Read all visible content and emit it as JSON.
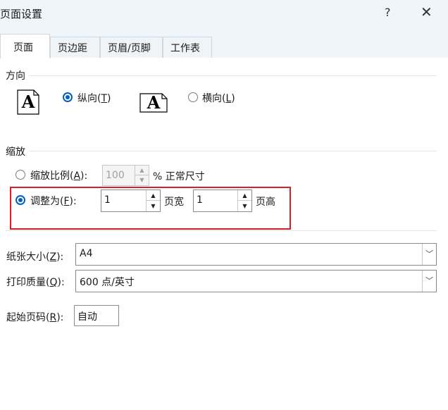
{
  "window": {
    "title": "页面设置",
    "help_label": "?",
    "close_label": "✕"
  },
  "tabs": [
    {
      "label": "页面",
      "active": true
    },
    {
      "label": "页边距",
      "active": false
    },
    {
      "label": "页眉/页脚",
      "active": false
    },
    {
      "label": "工作表",
      "active": false
    }
  ],
  "orientation": {
    "section_label": "方向",
    "portrait": {
      "label_prefix": "纵向(",
      "accesskey": "T",
      "label_suffix": ")",
      "checked": true,
      "icon_glyph": "A"
    },
    "landscape": {
      "label_prefix": "横向(",
      "accesskey": "L",
      "label_suffix": ")",
      "checked": false,
      "icon_glyph": "A"
    }
  },
  "scaling": {
    "section_label": "缩放",
    "adjust_percent": {
      "label_prefix": "缩放比例(",
      "accesskey": "A",
      "label_suffix": "):",
      "value": "100",
      "suffix": "% 正常尺寸",
      "checked": false
    },
    "fit_to": {
      "label_prefix": "调整为(",
      "accesskey": "F",
      "label_suffix": "):",
      "checked": true,
      "pages_wide": "1",
      "pages_wide_label": "页宽",
      "pages_tall": "1",
      "pages_tall_label": "页高"
    }
  },
  "paper_size": {
    "label_prefix": "纸张大小(",
    "accesskey": "Z",
    "label_suffix": "):",
    "value": "A4"
  },
  "print_quality": {
    "label_prefix": "打印质量(",
    "accesskey": "Q",
    "label_suffix": "):",
    "value": "600 点/英寸"
  },
  "first_page_number": {
    "label_prefix": "起始页码(",
    "accesskey": "R",
    "label_suffix": "):",
    "value": "自动"
  },
  "spin_up_glyph": "▲",
  "spin_down_glyph": "▼",
  "dropdown_glyph": "﹀",
  "colors": {
    "accent": "#0060c0",
    "highlight_box": "#d32029",
    "title_bg": "#eef6fb"
  }
}
